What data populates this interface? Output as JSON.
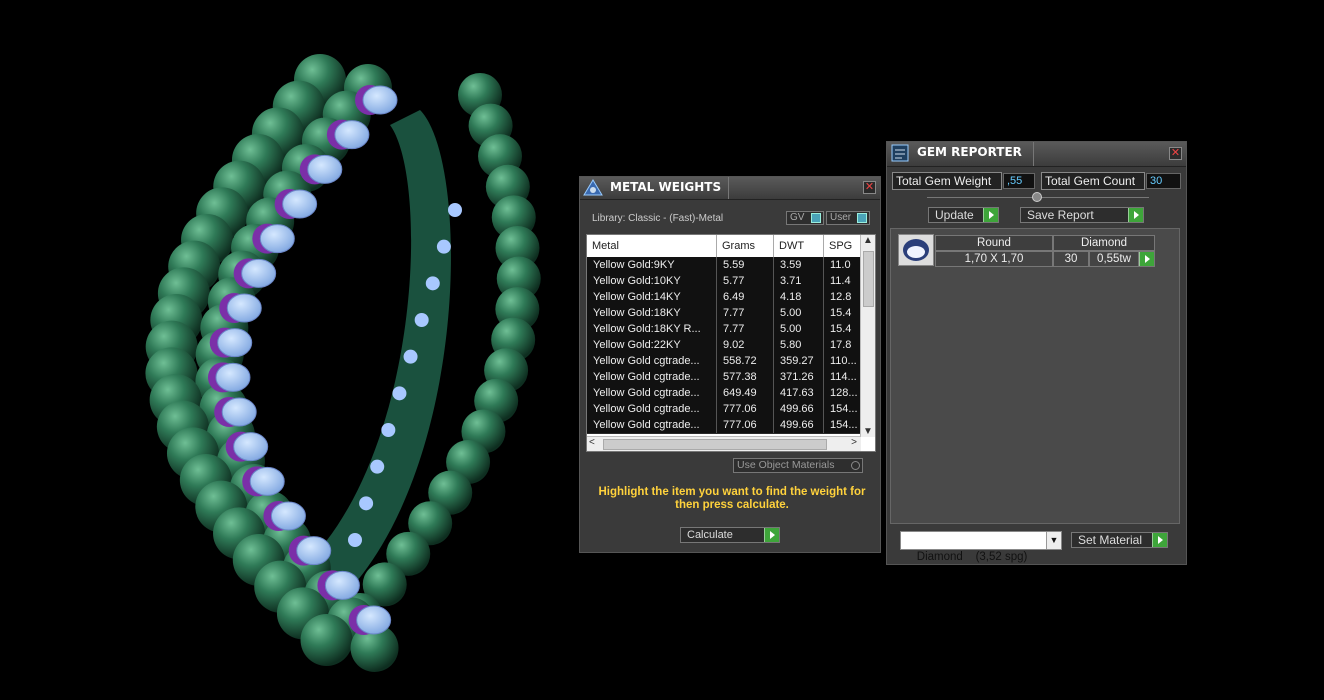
{
  "viewport": {
    "model": "eternity ring with green beads and round diamonds"
  },
  "metal_weights": {
    "title": "METAL WEIGHTS",
    "library": "Library: Classic - (Fast)-Metal",
    "toggle_gv": "GV",
    "toggle_user": "User",
    "columns": [
      "Metal",
      "Grams",
      "DWT",
      "SPG"
    ],
    "rows": [
      [
        "Yellow Gold:9KY",
        "5.59",
        "3.59",
        "11.0"
      ],
      [
        "Yellow Gold:10KY",
        "5.77",
        "3.71",
        "11.4"
      ],
      [
        "Yellow Gold:14KY",
        "6.49",
        "4.18",
        "12.8"
      ],
      [
        "Yellow Gold:18KY",
        "7.77",
        "5.00",
        "15.4"
      ],
      [
        "Yellow Gold:18KY R...",
        "7.77",
        "5.00",
        "15.4"
      ],
      [
        "Yellow Gold:22KY",
        "9.02",
        "5.80",
        "17.8"
      ],
      [
        "Yellow Gold cgtrade...",
        "558.72",
        "359.27",
        "110..."
      ],
      [
        "Yellow Gold cgtrade...",
        "577.38",
        "371.26",
        "114..."
      ],
      [
        "Yellow Gold cgtrade...",
        "649.49",
        "417.63",
        "128..."
      ],
      [
        "Yellow Gold cgtrade...",
        "777.06",
        "499.66",
        "154..."
      ],
      [
        "Yellow Gold cgtrade...",
        "777.06",
        "499.66",
        "154..."
      ]
    ],
    "use_object_materials": "Use Object Materials",
    "hint": "Highlight the item you want to find the weight for then press calculate.",
    "calculate": "Calculate"
  },
  "gem_reporter": {
    "title": "GEM REPORTER",
    "total_gem_weight_label": "Total Gem Weight",
    "total_gem_weight": ",55",
    "total_gem_count_label": "Total Gem Count",
    "total_gem_count": "30",
    "update": "Update",
    "save_report": "Save Report",
    "gem": {
      "shape": "Round",
      "material": "Diamond",
      "size": "1,70 X 1,70",
      "count": "30",
      "weight": "0,55tw"
    },
    "material_select": "Diamond    (3,52 spg)",
    "set_material": "Set Material"
  },
  "colors": {
    "accent_green": "#3ea53a",
    "hint_yellow": "#ffd23c",
    "value_blue": "#66ccff"
  }
}
